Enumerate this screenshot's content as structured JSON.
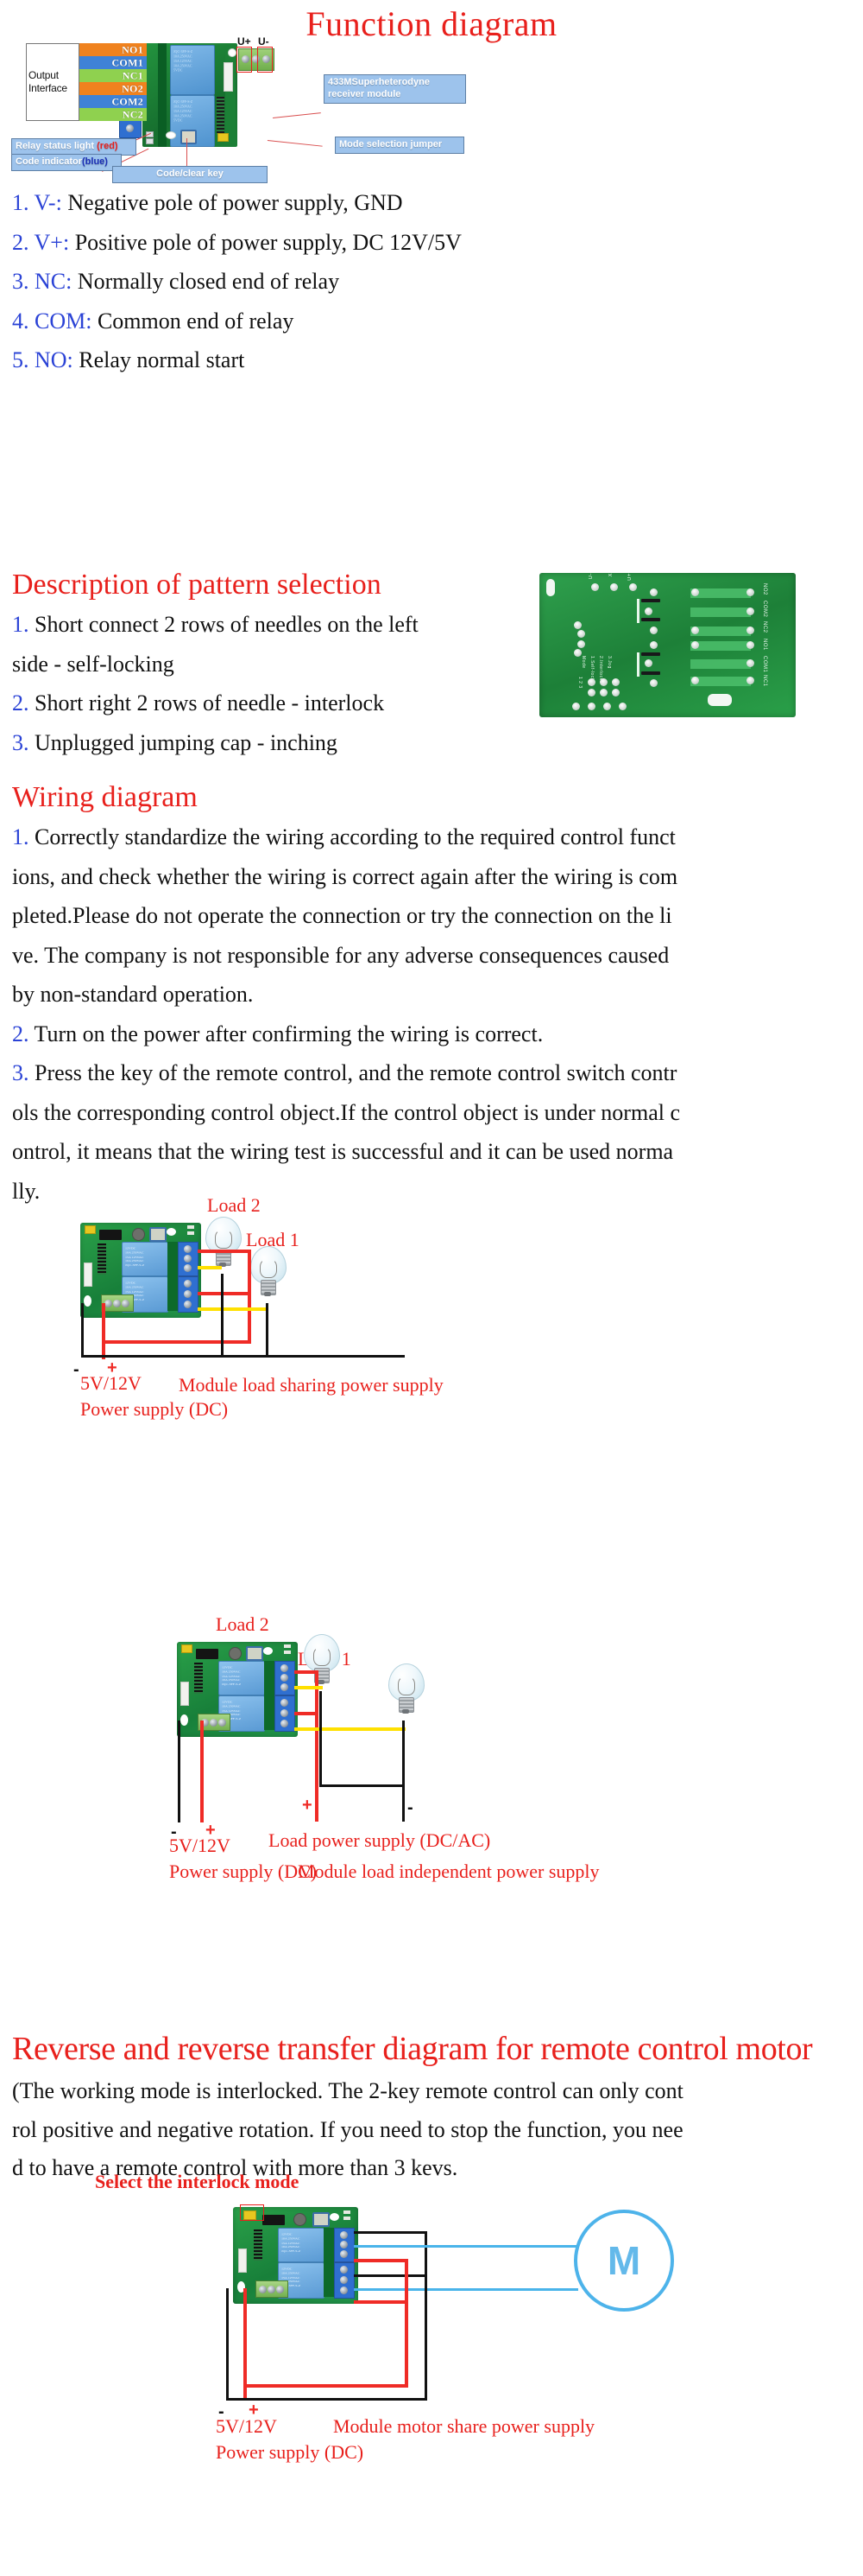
{
  "function_diagram": {
    "title": "Function diagram",
    "output_interface_label_line1": "Output",
    "output_interface_label_line2": "Interface",
    "terminal_stripes": [
      "NO1",
      "COM1",
      "NC1",
      "NO2",
      "COM2",
      "NC2"
    ],
    "power_labels": {
      "positive": "U+",
      "negative": "U-"
    },
    "callouts": {
      "receiver_module_line1": "433MSuperheterodyne",
      "receiver_module_line2": "receiver module",
      "mode_jumper": "Mode selection jumper",
      "relay_status_light": "Relay status light ",
      "relay_status_light_color": "(red)",
      "code_indicator": "Code indicator",
      "code_indicator_color": "(blue)",
      "code_clear_key": "Code/clear key"
    }
  },
  "terminal_list": [
    {
      "num": "1.",
      "key": "V-:",
      "text": "Negative pole of power supply, GND"
    },
    {
      "num": "2.",
      "key": "V+:",
      "text": "Positive pole of power supply, DC 12V/5V"
    },
    {
      "num": "3.",
      "key": "NC:",
      "text": "Normally closed end of relay"
    },
    {
      "num": "4.",
      "key": "COM:",
      "text": "Common end of relay"
    },
    {
      "num": "5.",
      "key": "NO:",
      "text": "Relay normal start"
    }
  ],
  "pattern_selection": {
    "title": "Description of pattern selection",
    "items": [
      {
        "num": "1.",
        "line1": "Short connect 2 rows of needles on the left",
        "line2": "side - self-locking"
      },
      {
        "num": "2.",
        "line1": "Short right 2 rows of needle - interlock",
        "line2": ""
      },
      {
        "num": "3.",
        "line1": "Unplugged jumping cap - inching",
        "line2": ""
      }
    ],
    "pcb_back_labels": [
      "U-",
      "X",
      "U+",
      "NO2",
      "COM2",
      "NC2",
      "NO1",
      "COM1",
      "NC1",
      "Mode",
      "1.Self-lock",
      "2.Interlock",
      "3.Jog",
      "1 2 3"
    ]
  },
  "wiring_diagram": {
    "title": "Wiring diagram",
    "item1_num": "1.",
    "item1_lines": [
      "Correctly standardize the wiring according to the required control funct",
      "ions, and check whether the wiring is correct again after the wiring is com",
      "pleted.Please do not operate the connection or try the connection on the li",
      "ve. The company is not responsible for any adverse consequences caused",
      "by non-standard operation."
    ],
    "item2_num": "2.",
    "item2_lines": [
      "Turn on the power after confirming the wiring is correct."
    ],
    "item3_num": "3.",
    "item3_lines": [
      "Press the key of the remote control, and the remote control switch contr",
      "ols the corresponding control object.If the control object is under normal c",
      "ontrol, it means that the wiring test is successful and it can be used norma",
      "lly."
    ]
  },
  "figure_shared": {
    "load2": "Load 2",
    "load1": "Load 1",
    "caption": "Module load sharing power supply",
    "voltage": "5V/12V",
    "supply": "Power supply (DC)",
    "plus": "+",
    "minus": "-"
  },
  "figure_independent": {
    "load2": "Load 2",
    "load1": "Load 1",
    "load_supply": "Load power supply (DC/AC)",
    "voltage": "5V/12V",
    "supply": "Power supply (DC)",
    "caption": "Module load independent power supply",
    "plus": "+",
    "minus": "-"
  },
  "motor_section": {
    "title": "Reverse and reverse transfer diagram for remote control motor",
    "note_lines": [
      "(The working mode is interlocked. The 2-key remote control can only cont",
      "rol positive and negative rotation. If you need to stop the function, you nee",
      "d to have a remote control with more than 3 kevs."
    ],
    "select_mode": "Select the interlock mode",
    "motor_symbol": "M",
    "voltage": "5V/12V",
    "supply": "Power supply (DC)",
    "caption": "Module motor share power supply",
    "plus": "+",
    "minus": "-"
  },
  "colors": {
    "heading_red": "#e8201c",
    "list_number_blue": "#2b43d6",
    "callout_bg": "#9dc3ec",
    "wire_red": "#ef2b26",
    "wire_yellow": "#ffe000",
    "wire_black": "#111111",
    "wire_blue": "#49b4ea",
    "pcb_green": "#1d8038",
    "relay_blue": "#5a9ad4",
    "motor_blue": "#63b9ea"
  }
}
